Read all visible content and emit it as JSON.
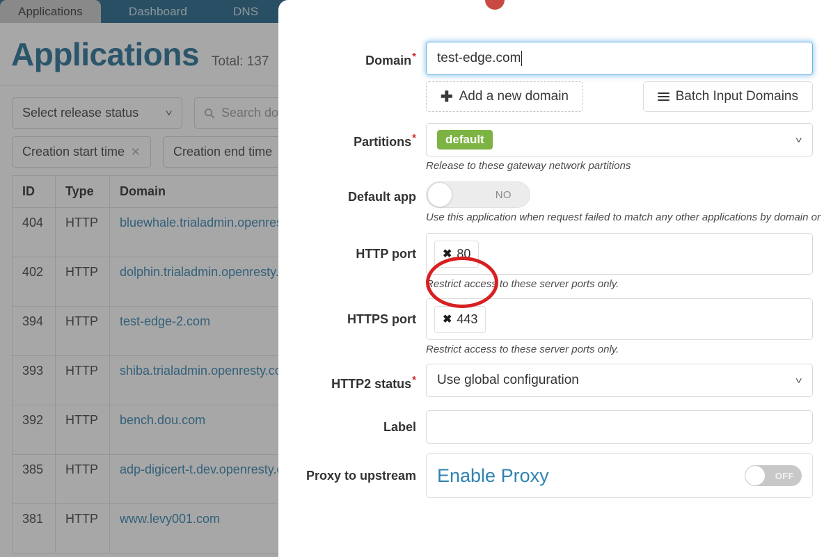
{
  "tabs": [
    {
      "label": "Applications",
      "active": true
    },
    {
      "label": "Dashboard",
      "active": false
    },
    {
      "label": "DNS",
      "active": false
    }
  ],
  "page": {
    "title": "Applications",
    "total": "Total: 137"
  },
  "filters": {
    "release_status": "Select release status",
    "search_placeholder": "Search do",
    "creation_start": "Creation start time",
    "creation_end": "Creation end time",
    "clear_symbol": "✕"
  },
  "table": {
    "columns": [
      "ID",
      "Type",
      "Domain"
    ],
    "rows": [
      {
        "id": "404",
        "type": "HTTP",
        "domain": "bluewhale.trialadmin.openrest"
      },
      {
        "id": "402",
        "type": "HTTP",
        "domain": "dolphin.trialadmin.openresty.c"
      },
      {
        "id": "394",
        "type": "HTTP",
        "domain": "test-edge-2.com"
      },
      {
        "id": "393",
        "type": "HTTP",
        "domain": "shiba.trialadmin.openresty.com"
      },
      {
        "id": "392",
        "type": "HTTP",
        "domain": "bench.dou.com"
      },
      {
        "id": "385",
        "type": "HTTP",
        "domain": "adp-digicert-t.dev.openresty.c"
      },
      {
        "id": "381",
        "type": "HTTP",
        "domain": "www.levy001.com"
      }
    ]
  },
  "modal": {
    "close_symbol": "✕",
    "fields": {
      "domain": {
        "label": "Domain",
        "required": "*",
        "value": "test-edge.com",
        "add_button": "Add a new domain",
        "add_icon": "✚",
        "batch_button": "Batch Input Domains"
      },
      "partitions": {
        "label": "Partitions",
        "required": "*",
        "tag": "default",
        "hint": "Release to these gateway network partitions"
      },
      "default_app": {
        "label": "Default app",
        "toggle_state": "NO",
        "hint": "Use this application when request failed to match any other applications by domain or IP."
      },
      "http_port": {
        "label": "HTTP port",
        "tag_value": "80",
        "tag_remove": "✖",
        "hint": "Restrict access to these server ports only."
      },
      "https_port": {
        "label": "HTTPS port",
        "tag_value": "443",
        "tag_remove": "✖",
        "hint": "Restrict access to these server ports only."
      },
      "http2_status": {
        "label": "HTTP2 status",
        "required": "*",
        "value": "Use global configuration"
      },
      "label_field": {
        "label": "Label",
        "value": ""
      },
      "proxy_upstream": {
        "label": "Proxy to upstream",
        "link": "Enable Proxy",
        "toggle_state": "OFF"
      }
    }
  },
  "colors": {
    "tabbar": "#1a6086",
    "title": "#1c6a92",
    "link": "#2a7fad",
    "tag_green": "#7cb342",
    "required_red": "#cc2b2b",
    "annotation_red": "#d81f21",
    "alert_badge": "#c94a42"
  }
}
